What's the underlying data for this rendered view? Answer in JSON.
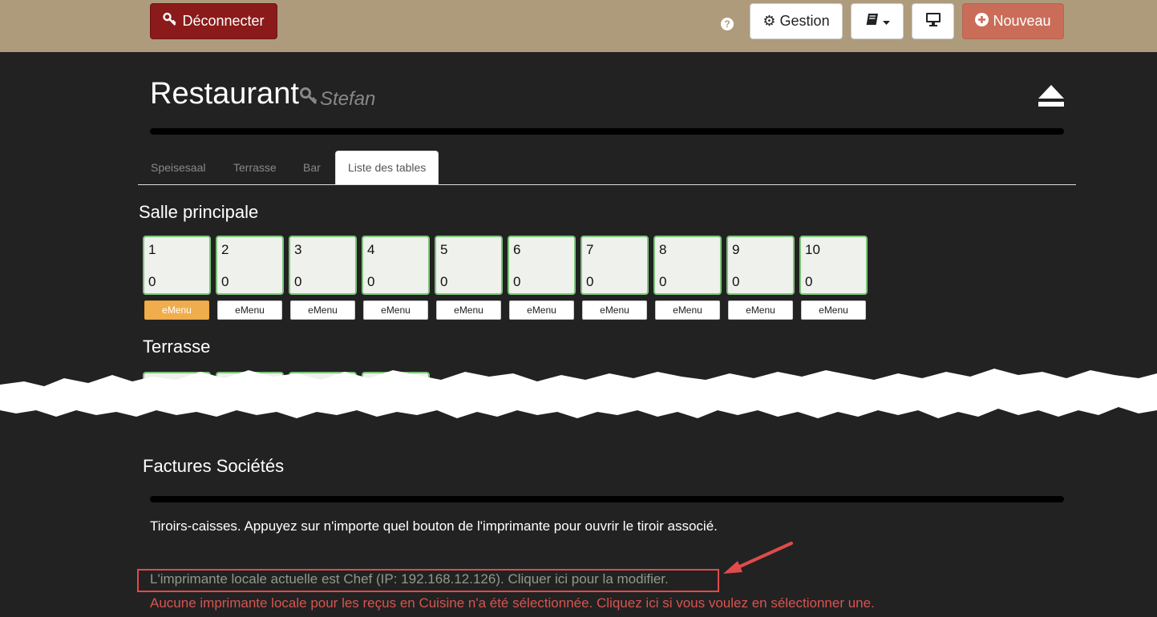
{
  "topbar": {
    "logout_label": "Déconnecter",
    "help_icon": "question-circle-icon",
    "gestion_label": "Gestion",
    "book_icon": "book-icon",
    "monitor_icon": "desktop-icon",
    "new_label": "Nouveau"
  },
  "header": {
    "title": "Restaurant",
    "user": "Stefan",
    "key_icon": "key-icon",
    "eject_icon": "eject-icon"
  },
  "tabs": [
    {
      "label": "Speisesaal"
    },
    {
      "label": "Terrasse"
    },
    {
      "label": "Bar"
    },
    {
      "label": "Liste des tables",
      "active": true
    }
  ],
  "sections": {
    "main_room": "Salle principale",
    "terrace": "Terrasse",
    "company_invoices": "Factures Sociétés"
  },
  "tables": [
    {
      "number": "1",
      "count": "0",
      "emenu": "eMenu"
    },
    {
      "number": "2",
      "count": "0",
      "emenu": "eMenu"
    },
    {
      "number": "3",
      "count": "0",
      "emenu": "eMenu"
    },
    {
      "number": "4",
      "count": "0",
      "emenu": "eMenu"
    },
    {
      "number": "5",
      "count": "0",
      "emenu": "eMenu"
    },
    {
      "number": "6",
      "count": "0",
      "emenu": "eMenu"
    },
    {
      "number": "7",
      "count": "0",
      "emenu": "eMenu"
    },
    {
      "number": "8",
      "count": "0",
      "emenu": "eMenu"
    },
    {
      "number": "9",
      "count": "0",
      "emenu": "eMenu"
    },
    {
      "number": "10",
      "count": "0",
      "emenu": "eMenu"
    }
  ],
  "cash_drawer_info": "Tiroirs-caisses. Appuyez sur n'importe quel bouton de l'imprimante pour ouvrir le tiroir associé.",
  "local_printer_text": "L'imprimante locale actuelle est Chef (IP: 192.168.12.126). Cliquer ici pour la modifier.",
  "kitchen_printer_text": "Aucune imprimante locale pour les reçus en Cuisine n'a été sélectionnée. Cliquez ici si vous voulez en sélectionner une.",
  "colors": {
    "topbar": "#ae9b7c",
    "background": "#222222",
    "logout": "#8b1a1a",
    "new": "#c96d59",
    "table_border": "#7cc37a",
    "emenu_active": "#f0ad4e",
    "highlight": "#e04b4b"
  }
}
